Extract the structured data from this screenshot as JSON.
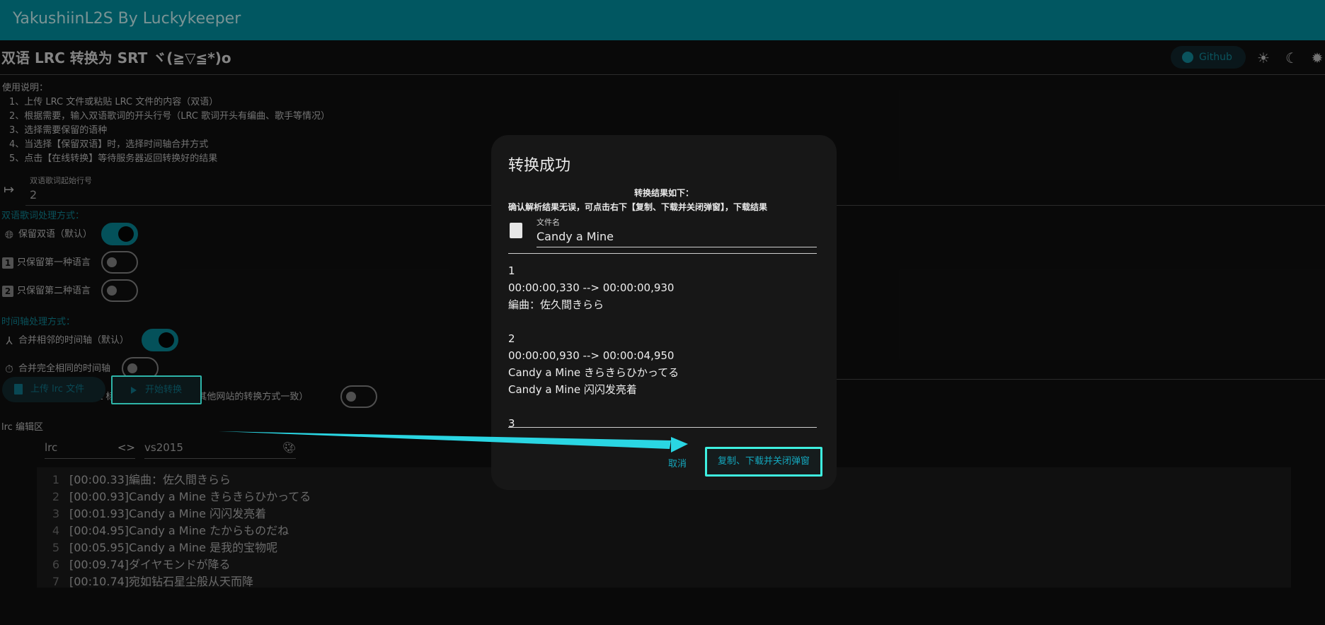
{
  "app": {
    "title": "YakushiinL2S By Luckykeeper"
  },
  "header": {
    "title": "双语 LRC 转换为 SRT ヾ(≧▽≦*)o",
    "github_label": "Github",
    "icons": [
      "github-icon",
      "sun-icon",
      "moon-icon",
      "auto-theme-icon"
    ]
  },
  "instructions": {
    "heading": "使用说明：",
    "items": [
      "1、上传 LRC 文件或粘贴 LRC 文件的内容（双语）",
      "2、根据需要，输入双语歌词的开头行号（LRC 歌词开头有编曲、歌手等情况）",
      "3、选择需要保留的语种",
      "4、当选择【保留双语】时，选择时间轴合并方式",
      "5、点击【在线转换】等待服务器返回转换好的结果"
    ]
  },
  "start_line": {
    "label": "双语歌词起始行号",
    "value": "2"
  },
  "lyric_mode": {
    "label": "双语歌词处理方式：",
    "options": [
      {
        "label": "保留双语（默认）",
        "icon": "globe-icon",
        "on": true
      },
      {
        "label": "只保留第一种语言",
        "icon": "one-icon",
        "on": false
      },
      {
        "label": "只保留第二种语言",
        "icon": "two-icon",
        "on": false
      }
    ]
  },
  "timeline_mode": {
    "label": "时间轴处理方式：",
    "options": [
      {
        "label": "合并相邻的时间轴（默认）",
        "icon": "merge-icon",
        "on": true
      },
      {
        "label": "合并完全相同的时间轴",
        "icon": "timer-icon",
        "on": false
      },
      {
        "label": "不要合并（lrc 转 srt 标准通用转换模式，和其他网站的转换方式一致）",
        "icon": "split-icon",
        "on": false
      }
    ]
  },
  "actions": {
    "upload_label": "上传 lrc 文件",
    "convert_label": "开始转换"
  },
  "editor": {
    "label": "lrc 编辑区",
    "language": "lrc",
    "theme": "vs2015",
    "lines": [
      {
        "n": "1",
        "text": "[00:00.33]編曲：佐久間きらら"
      },
      {
        "n": "2",
        "text": "[00:00.93]Candy a Mine きらきらひかってる"
      },
      {
        "n": "3",
        "text": "[00:01.93]Candy a Mine 闪闪发亮着"
      },
      {
        "n": "4",
        "text": "[00:04.95]Candy a Mine たからものだね"
      },
      {
        "n": "5",
        "text": "[00:05.95]Candy a Mine 是我的宝物呢"
      },
      {
        "n": "6",
        "text": "[00:09.74]ダイヤモンドが降る"
      },
      {
        "n": "7",
        "text": "[00:10.74]宛如钻石星尘般从天而降"
      }
    ]
  },
  "dialog": {
    "title": "转换成功",
    "line1": "转换结果如下：",
    "line2": "确认解析结果无误，可点击右下【复制、下载并关闭弹窗】，下载结果",
    "filename_label": "文件名",
    "filename_value": "Candy a Mine",
    "srt_blocks": [
      {
        "index": "1",
        "time": "00:00:00,330 --> 00:00:00,930",
        "lines": [
          "編曲：佐久間きらら"
        ]
      },
      {
        "index": "2",
        "time": "00:00:00,930 --> 00:00:04,950",
        "lines": [
          "Candy a Mine きらきらひかってる",
          "Candy a Mine 闪闪发亮着"
        ]
      },
      {
        "index": "3",
        "time": "",
        "lines": []
      }
    ],
    "cancel_label": "取消",
    "confirm_label": "复制、下载并关闭弹窗"
  },
  "colors": {
    "accent": "#0c6c78",
    "appbar": "#027582",
    "highlight": "#3ef0e0"
  }
}
